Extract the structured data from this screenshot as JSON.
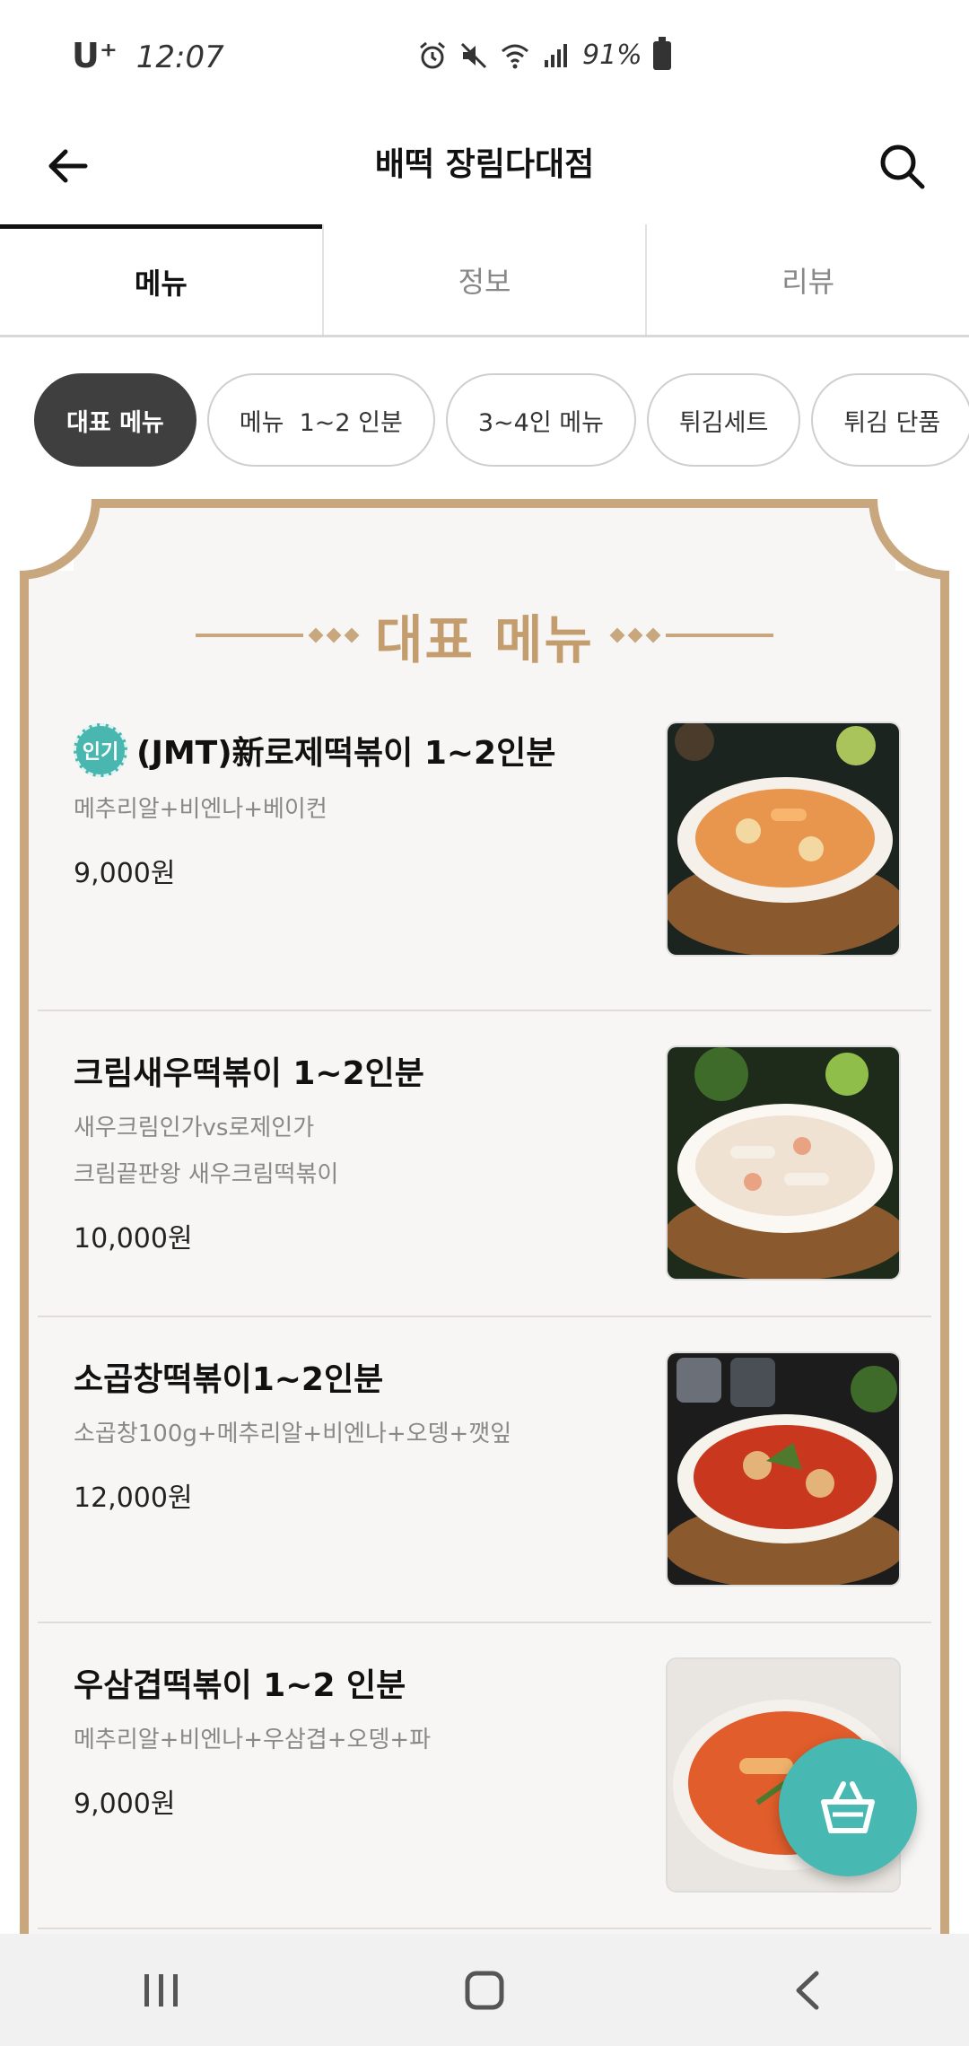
{
  "status_bar": {
    "carrier": "U⁺",
    "time": "12:07",
    "battery": "91%"
  },
  "header": {
    "title": "배떡 장림다대점"
  },
  "tabs": [
    {
      "label": "메뉴",
      "active": true
    },
    {
      "label": "정보",
      "active": false
    },
    {
      "label": "리뷰",
      "active": false
    }
  ],
  "chips": [
    {
      "label": "대표 메뉴",
      "active": true
    },
    {
      "label": "메뉴  1~2 인분",
      "active": false
    },
    {
      "label": "3~4인 메뉴",
      "active": false
    },
    {
      "label": "튀김세트",
      "active": false
    },
    {
      "label": "튀김 단품",
      "active": false
    }
  ],
  "section": {
    "title": "대표 메뉴"
  },
  "items": [
    {
      "badge": "인기",
      "name": "(JMT)新로제떡볶이 1~2인분",
      "desc": [
        "메추리알+비엔나+베이컨"
      ],
      "price": "9,000원",
      "image": "rose-tteokbokki-photo"
    },
    {
      "badge": "",
      "name": "크림새우떡볶이 1~2인분",
      "desc": [
        "새우크림인가vs로제인가",
        "크림끝판왕 새우크림떡볶이"
      ],
      "price": "10,000원",
      "image": "cream-shrimp-tteokbokki-photo"
    },
    {
      "badge": "",
      "name": "소곱창떡볶이1~2인분",
      "desc": [
        "소곱창100g+메추리알+비엔나+오뎅+깻잎"
      ],
      "price": "12,000원",
      "image": "gopchang-tteokbokki-photo"
    },
    {
      "badge": "",
      "name": "우삼겹떡볶이 1~2 인분",
      "desc": [
        "메추리알+비엔나+우삼겹+오뎅+파"
      ],
      "price": "9,000원",
      "image": "usamgyeop-tteokbokki-photo"
    }
  ],
  "colors": {
    "accent": "#47b8b2",
    "gold": "#c8a77f",
    "chip_active": "#3f3f3f"
  }
}
